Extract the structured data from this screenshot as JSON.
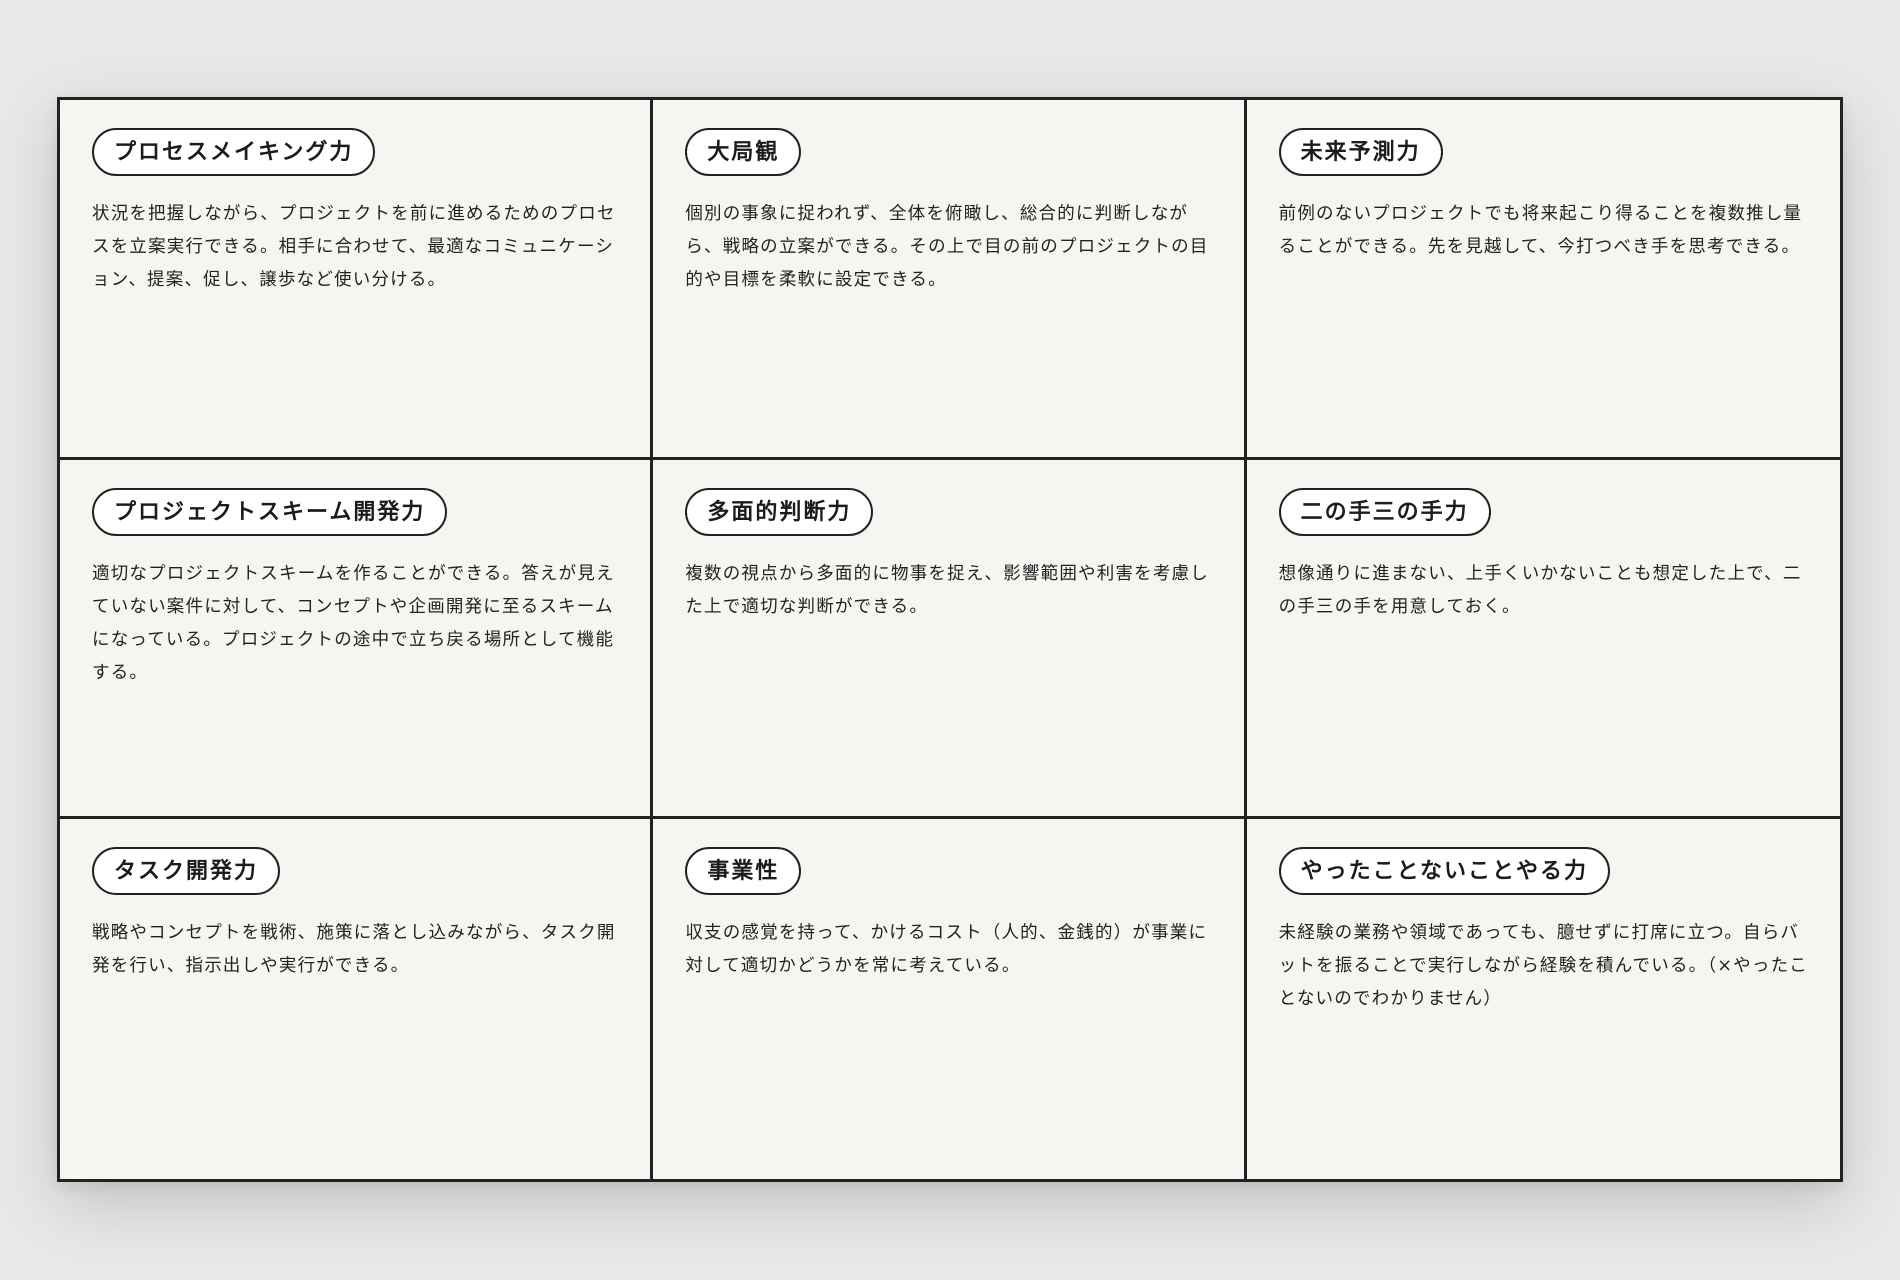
{
  "cards": [
    {
      "title": "プロセスメイキング力",
      "body": "状況を把握しながら、プロジェクトを前に進めるためのプロセスを立案実行できる。相手に合わせて、最適なコミュニケーション、提案、促し、譲歩など使い分ける。"
    },
    {
      "title": "大局観",
      "body": "個別の事象に捉われず、全体を俯瞰し、総合的に判断しながら、戦略の立案ができる。その上で目の前のプロジェクトの目的や目標を柔軟に設定できる。"
    },
    {
      "title": "未来予測力",
      "body": "前例のないプロジェクトでも将来起こり得ることを複数推し量ることができる。先を見越して、今打つべき手を思考できる。"
    },
    {
      "title": "プロジェクトスキーム開発力",
      "body": "適切なプロジェクトスキームを作ることができる。答えが見えていない案件に対して、コンセプトや企画開発に至るスキームになっている。プロジェクトの途中で立ち戻る場所として機能する。"
    },
    {
      "title": "多面的判断力",
      "body": "複数の視点から多面的に物事を捉え、影響範囲や利害を考慮した上で適切な判断ができる。"
    },
    {
      "title": "二の手三の手力",
      "body": "想像通りに進まない、上手くいかないことも想定した上で、二の手三の手を用意しておく。"
    },
    {
      "title": "タスク開発力",
      "body": "戦略やコンセプトを戦術、施策に落とし込みながら、タスク開発を行い、指示出しや実行ができる。"
    },
    {
      "title": "事業性",
      "body": "収支の感覚を持って、かけるコスト（人的、金銭的）が事業に対して適切かどうかを常に考えている。"
    },
    {
      "title": "やったことないことやる力",
      "body": "未経験の業務や領域であっても、臆せずに打席に立つ。自らバットを振ることで実行しながら経験を積んでいる。（×やったことないのでわかりません）"
    }
  ]
}
